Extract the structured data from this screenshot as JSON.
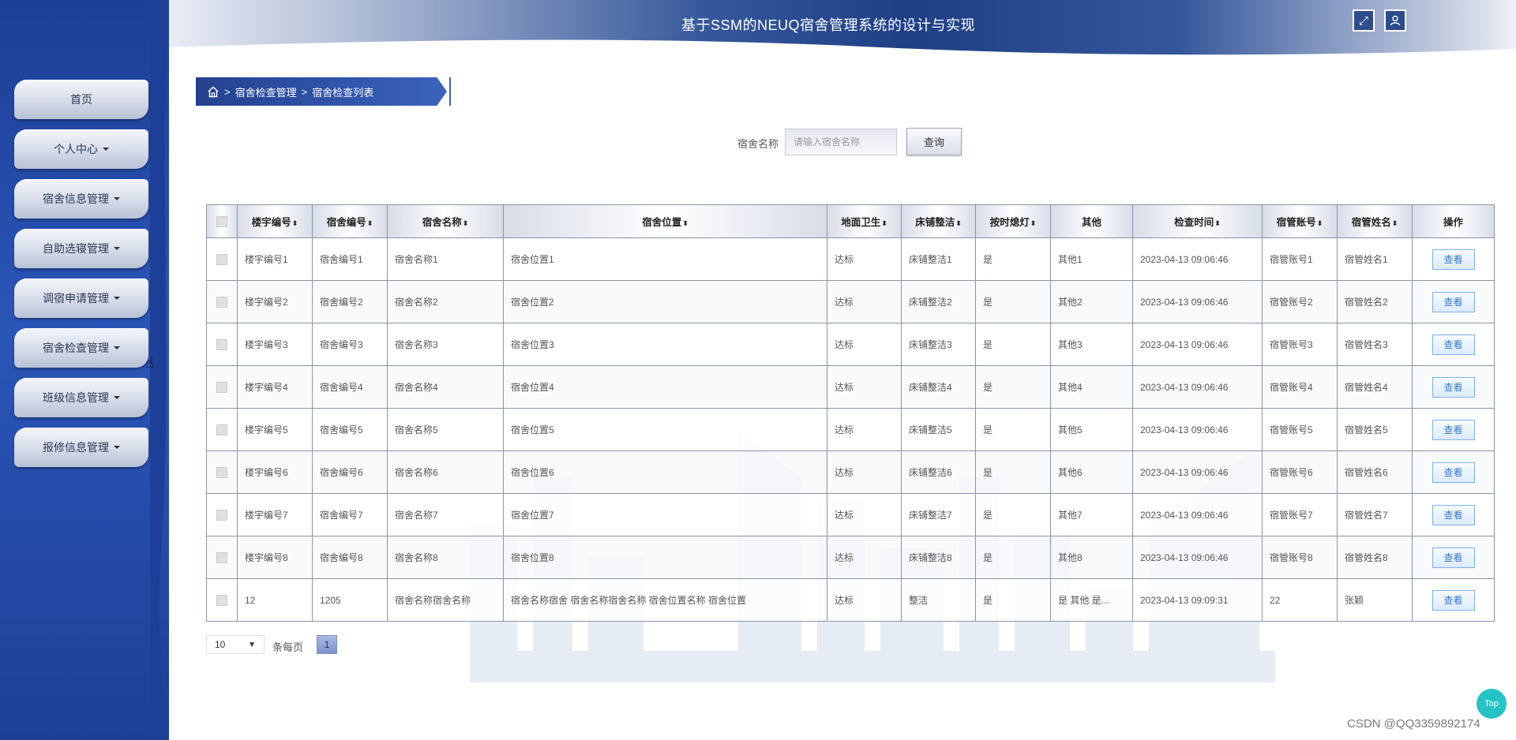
{
  "header": {
    "title": "基于SSM的NEUQ宿舍管理系统的设计与实现"
  },
  "sidebar": {
    "items": [
      {
        "label": "首页",
        "has_dropdown": false
      },
      {
        "label": "个人中心",
        "has_dropdown": true
      },
      {
        "label": "宿舍信息管理",
        "has_dropdown": true
      },
      {
        "label": "自助选寝管理",
        "has_dropdown": true
      },
      {
        "label": "调宿申请管理",
        "has_dropdown": true
      },
      {
        "label": "宿舍检查管理",
        "has_dropdown": true
      },
      {
        "label": "班级信息管理",
        "has_dropdown": true
      },
      {
        "label": "报修信息管理",
        "has_dropdown": true
      }
    ]
  },
  "breadcrumb": {
    "sep": ">",
    "level1": "宿舍检查管理",
    "level2": "宿舍检查列表"
  },
  "search": {
    "label": "宿舍名称",
    "placeholder": "请输入宿舍名称",
    "button": "查询"
  },
  "table": {
    "headers": [
      "楼宇编号",
      "宿舍编号",
      "宿舍名称",
      "宿舍位置",
      "地面卫生",
      "床铺整洁",
      "按时熄灯",
      "其他",
      "检查时间",
      "宿管账号",
      "宿管姓名",
      "操作"
    ],
    "sortable": [
      true,
      true,
      true,
      true,
      true,
      true,
      true,
      false,
      true,
      true,
      true,
      false
    ],
    "view_label": "查看",
    "rows": [
      [
        "楼宇编号1",
        "宿舍编号1",
        "宿舍名称1",
        "宿舍位置1",
        "达标",
        "床铺整洁1",
        "是",
        "其他1",
        "2023-04-13 09:06:46",
        "宿管账号1",
        "宿管姓名1"
      ],
      [
        "楼宇编号2",
        "宿舍编号2",
        "宿舍名称2",
        "宿舍位置2",
        "达标",
        "床铺整洁2",
        "是",
        "其他2",
        "2023-04-13 09:06:46",
        "宿管账号2",
        "宿管姓名2"
      ],
      [
        "楼宇编号3",
        "宿舍编号3",
        "宿舍名称3",
        "宿舍位置3",
        "达标",
        "床铺整洁3",
        "是",
        "其他3",
        "2023-04-13 09:06:46",
        "宿管账号3",
        "宿管姓名3"
      ],
      [
        "楼宇编号4",
        "宿舍编号4",
        "宿舍名称4",
        "宿舍位置4",
        "达标",
        "床铺整洁4",
        "是",
        "其他4",
        "2023-04-13 09:06:46",
        "宿管账号4",
        "宿管姓名4"
      ],
      [
        "楼宇编号5",
        "宿舍编号5",
        "宿舍名称5",
        "宿舍位置5",
        "达标",
        "床铺整洁5",
        "是",
        "其他5",
        "2023-04-13 09:06:46",
        "宿管账号5",
        "宿管姓名5"
      ],
      [
        "楼宇编号6",
        "宿舍编号6",
        "宿舍名称6",
        "宿舍位置6",
        "达标",
        "床铺整洁6",
        "是",
        "其他6",
        "2023-04-13 09:06:46",
        "宿管账号6",
        "宿管姓名6"
      ],
      [
        "楼宇编号7",
        "宿舍编号7",
        "宿舍名称7",
        "宿舍位置7",
        "达标",
        "床铺整洁7",
        "是",
        "其他7",
        "2023-04-13 09:06:46",
        "宿管账号7",
        "宿管姓名7"
      ],
      [
        "楼宇编号8",
        "宿舍编号8",
        "宿舍名称8",
        "宿舍位置8",
        "达标",
        "床铺整洁8",
        "是",
        "其他8",
        "2023-04-13 09:06:46",
        "宿管账号8",
        "宿管姓名8"
      ],
      [
        "12",
        "1205",
        "宿舍名称宿舍名称",
        "宿舍名称宿舍 宿舍名称宿舍名称 宿舍位置名称 宿舍位置",
        "达标",
        "整洁",
        "是",
        "是 其他 是...",
        "2023-04-13 09:09:31",
        "22",
        "张颖"
      ]
    ]
  },
  "pagination": {
    "page_size": "10",
    "per_page_label": "条每页",
    "current_page": "1"
  },
  "top_button": "Top",
  "watermark_text": "CSDN @QQ3359892174",
  "icons": {
    "home": "home-icon",
    "fullscreen": "fullscreen-icon",
    "user": "user-icon",
    "cursor": "hand-cursor-icon"
  },
  "colors": {
    "sidebar": "#2a56b8",
    "header_dark": "#1f3f85",
    "accent_button": "#3a79c4",
    "top_button": "#26c3c6"
  }
}
